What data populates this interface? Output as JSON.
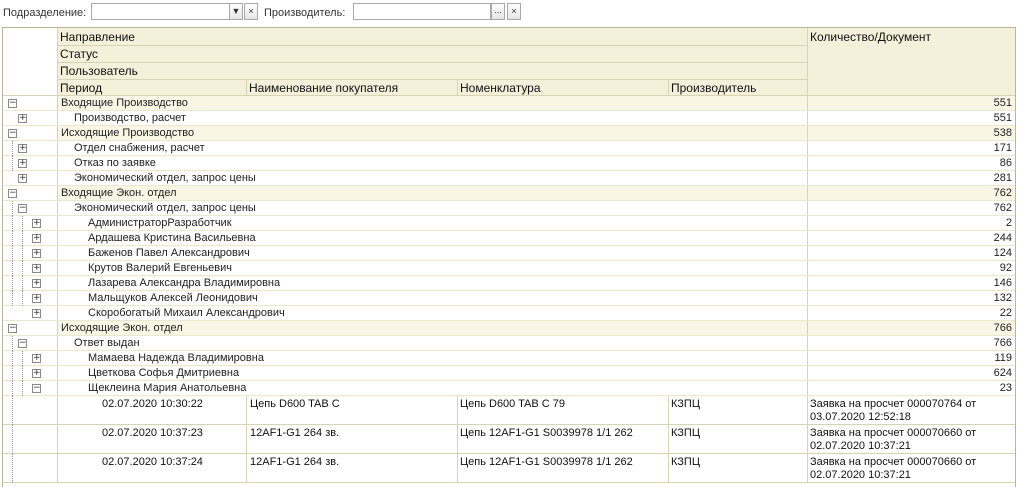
{
  "filters": {
    "division_label": "Подразделение:",
    "division_value": "",
    "manufacturer_label": "Производитель:",
    "manufacturer_value": "",
    "dropdown_glyph": "▼",
    "clear_glyph": "×",
    "select_glyph": "..."
  },
  "columns": {
    "direction": "Направление",
    "status": "Статус",
    "user": "Пользователь",
    "period": "Период",
    "buyer": "Наименование покупателя",
    "nomenclature": "Номенклатура",
    "manufacturer": "Производитель",
    "quantity": "Количество/Документ"
  },
  "rows": [
    {
      "level": 0,
      "state": "expanded",
      "label": "Входящие Производство",
      "qty": "551"
    },
    {
      "level": 1,
      "state": "collapsed",
      "label": "Производство, расчет",
      "qty": "551"
    },
    {
      "level": 0,
      "state": "expanded",
      "label": "Исходящие Производство",
      "qty": "538"
    },
    {
      "level": 1,
      "state": "collapsed",
      "label": "Отдел снабжения, расчет",
      "qty": "171"
    },
    {
      "level": 1,
      "state": "collapsed",
      "label": "Отказ по заявке",
      "qty": "86"
    },
    {
      "level": 1,
      "state": "collapsed",
      "label": "Экономический отдел, запрос цены",
      "qty": "281"
    },
    {
      "level": 0,
      "state": "expanded",
      "label": "Входящие Экон. отдел",
      "qty": "762"
    },
    {
      "level": 1,
      "state": "expanded",
      "label": "Экономический отдел, запрос цены",
      "qty": "762"
    },
    {
      "level": 2,
      "state": "collapsed",
      "label": "АдминистраторРазработчик",
      "qty": "2"
    },
    {
      "level": 2,
      "state": "collapsed",
      "label": "Ардашева Кристина Васильевна",
      "qty": "244"
    },
    {
      "level": 2,
      "state": "collapsed",
      "label": "Баженов Павел Александрович",
      "qty": "124"
    },
    {
      "level": 2,
      "state": "collapsed",
      "label": "Крутов Валерий Евгеньевич",
      "qty": "92"
    },
    {
      "level": 2,
      "state": "collapsed",
      "label": "Лазарева Александра Владимировна",
      "qty": "146"
    },
    {
      "level": 2,
      "state": "collapsed",
      "label": "Мальщуков Алексей Леонидович",
      "qty": "132"
    },
    {
      "level": 2,
      "state": "collapsed",
      "label": "Скоробогатый Михаил Александрович",
      "qty": "22"
    },
    {
      "level": 0,
      "state": "expanded",
      "label": "Исходящие Экон. отдел",
      "qty": "766"
    },
    {
      "level": 1,
      "state": "expanded",
      "label": "Ответ выдан",
      "qty": "766"
    },
    {
      "level": 2,
      "state": "collapsed",
      "label": "Мамаева Надежда Владимировна",
      "qty": "119"
    },
    {
      "level": 2,
      "state": "collapsed",
      "label": "Цветкова Софья Дмитриевна",
      "qty": "624"
    },
    {
      "level": 2,
      "state": "expanded",
      "label": "Щеклеина Мария Анатольевна",
      "qty": "23"
    }
  ],
  "details": [
    {
      "period": "02.07.2020 10:30:22",
      "buyer": "Цепь D600 TAB C",
      "nomenclature": "Цепь D600 TAB C 79",
      "manufacturer": "КЗПЦ",
      "doc_line1": "Заявка на просчет 000070764 от",
      "doc_line2": "03.07.2020 12:52:18"
    },
    {
      "period": "02.07.2020 10:37:23",
      "buyer": "12AF1-G1 264 зв.",
      "nomenclature": "Цепь 12AF1-G1 S0039978 1/1 262",
      "manufacturer": "КЗПЦ",
      "doc_line1": "Заявка на просчет 000070660 от",
      "doc_line2": "02.07.2020 10:37:21"
    },
    {
      "period": "02.07.2020 10:37:24",
      "buyer": "12AF1-G1 264 зв.",
      "nomenclature": "Цепь 12AF1-G1 S0039978 1/1 262",
      "manufacturer": "КЗПЦ",
      "doc_line1": "Заявка на просчет 000070660 от",
      "doc_line2": "02.07.2020 10:37:21"
    }
  ],
  "colors": {
    "group_bg": "#f9f6e6",
    "header_bg": "#f4f0d9",
    "grid_line": "#d8d3b4"
  }
}
